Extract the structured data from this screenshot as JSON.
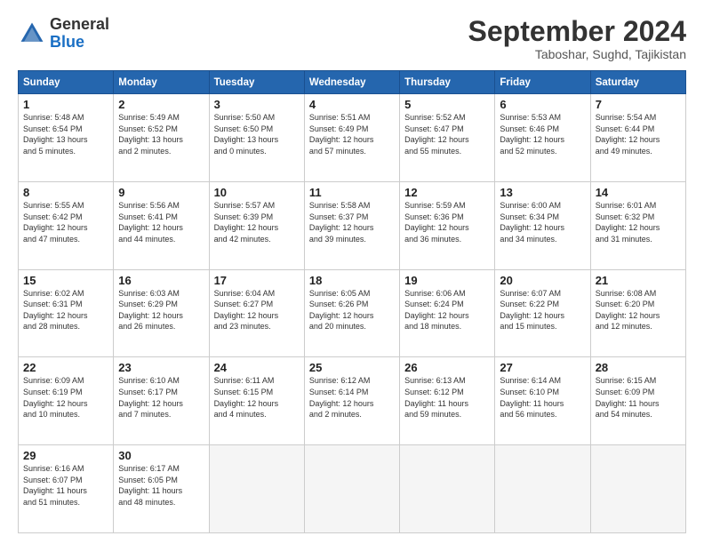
{
  "header": {
    "logo_general": "General",
    "logo_blue": "Blue",
    "month_year": "September 2024",
    "location": "Taboshar, Sughd, Tajikistan"
  },
  "weekdays": [
    "Sunday",
    "Monday",
    "Tuesday",
    "Wednesday",
    "Thursday",
    "Friday",
    "Saturday"
  ],
  "weeks": [
    [
      {
        "day": "1",
        "lines": [
          "Sunrise: 5:48 AM",
          "Sunset: 6:54 PM",
          "Daylight: 13 hours",
          "and 5 minutes."
        ]
      },
      {
        "day": "2",
        "lines": [
          "Sunrise: 5:49 AM",
          "Sunset: 6:52 PM",
          "Daylight: 13 hours",
          "and 2 minutes."
        ]
      },
      {
        "day": "3",
        "lines": [
          "Sunrise: 5:50 AM",
          "Sunset: 6:50 PM",
          "Daylight: 13 hours",
          "and 0 minutes."
        ]
      },
      {
        "day": "4",
        "lines": [
          "Sunrise: 5:51 AM",
          "Sunset: 6:49 PM",
          "Daylight: 12 hours",
          "and 57 minutes."
        ]
      },
      {
        "day": "5",
        "lines": [
          "Sunrise: 5:52 AM",
          "Sunset: 6:47 PM",
          "Daylight: 12 hours",
          "and 55 minutes."
        ]
      },
      {
        "day": "6",
        "lines": [
          "Sunrise: 5:53 AM",
          "Sunset: 6:46 PM",
          "Daylight: 12 hours",
          "and 52 minutes."
        ]
      },
      {
        "day": "7",
        "lines": [
          "Sunrise: 5:54 AM",
          "Sunset: 6:44 PM",
          "Daylight: 12 hours",
          "and 49 minutes."
        ]
      }
    ],
    [
      {
        "day": "8",
        "lines": [
          "Sunrise: 5:55 AM",
          "Sunset: 6:42 PM",
          "Daylight: 12 hours",
          "and 47 minutes."
        ]
      },
      {
        "day": "9",
        "lines": [
          "Sunrise: 5:56 AM",
          "Sunset: 6:41 PM",
          "Daylight: 12 hours",
          "and 44 minutes."
        ]
      },
      {
        "day": "10",
        "lines": [
          "Sunrise: 5:57 AM",
          "Sunset: 6:39 PM",
          "Daylight: 12 hours",
          "and 42 minutes."
        ]
      },
      {
        "day": "11",
        "lines": [
          "Sunrise: 5:58 AM",
          "Sunset: 6:37 PM",
          "Daylight: 12 hours",
          "and 39 minutes."
        ]
      },
      {
        "day": "12",
        "lines": [
          "Sunrise: 5:59 AM",
          "Sunset: 6:36 PM",
          "Daylight: 12 hours",
          "and 36 minutes."
        ]
      },
      {
        "day": "13",
        "lines": [
          "Sunrise: 6:00 AM",
          "Sunset: 6:34 PM",
          "Daylight: 12 hours",
          "and 34 minutes."
        ]
      },
      {
        "day": "14",
        "lines": [
          "Sunrise: 6:01 AM",
          "Sunset: 6:32 PM",
          "Daylight: 12 hours",
          "and 31 minutes."
        ]
      }
    ],
    [
      {
        "day": "15",
        "lines": [
          "Sunrise: 6:02 AM",
          "Sunset: 6:31 PM",
          "Daylight: 12 hours",
          "and 28 minutes."
        ]
      },
      {
        "day": "16",
        "lines": [
          "Sunrise: 6:03 AM",
          "Sunset: 6:29 PM",
          "Daylight: 12 hours",
          "and 26 minutes."
        ]
      },
      {
        "day": "17",
        "lines": [
          "Sunrise: 6:04 AM",
          "Sunset: 6:27 PM",
          "Daylight: 12 hours",
          "and 23 minutes."
        ]
      },
      {
        "day": "18",
        "lines": [
          "Sunrise: 6:05 AM",
          "Sunset: 6:26 PM",
          "Daylight: 12 hours",
          "and 20 minutes."
        ]
      },
      {
        "day": "19",
        "lines": [
          "Sunrise: 6:06 AM",
          "Sunset: 6:24 PM",
          "Daylight: 12 hours",
          "and 18 minutes."
        ]
      },
      {
        "day": "20",
        "lines": [
          "Sunrise: 6:07 AM",
          "Sunset: 6:22 PM",
          "Daylight: 12 hours",
          "and 15 minutes."
        ]
      },
      {
        "day": "21",
        "lines": [
          "Sunrise: 6:08 AM",
          "Sunset: 6:20 PM",
          "Daylight: 12 hours",
          "and 12 minutes."
        ]
      }
    ],
    [
      {
        "day": "22",
        "lines": [
          "Sunrise: 6:09 AM",
          "Sunset: 6:19 PM",
          "Daylight: 12 hours",
          "and 10 minutes."
        ]
      },
      {
        "day": "23",
        "lines": [
          "Sunrise: 6:10 AM",
          "Sunset: 6:17 PM",
          "Daylight: 12 hours",
          "and 7 minutes."
        ]
      },
      {
        "day": "24",
        "lines": [
          "Sunrise: 6:11 AM",
          "Sunset: 6:15 PM",
          "Daylight: 12 hours",
          "and 4 minutes."
        ]
      },
      {
        "day": "25",
        "lines": [
          "Sunrise: 6:12 AM",
          "Sunset: 6:14 PM",
          "Daylight: 12 hours",
          "and 2 minutes."
        ]
      },
      {
        "day": "26",
        "lines": [
          "Sunrise: 6:13 AM",
          "Sunset: 6:12 PM",
          "Daylight: 11 hours",
          "and 59 minutes."
        ]
      },
      {
        "day": "27",
        "lines": [
          "Sunrise: 6:14 AM",
          "Sunset: 6:10 PM",
          "Daylight: 11 hours",
          "and 56 minutes."
        ]
      },
      {
        "day": "28",
        "lines": [
          "Sunrise: 6:15 AM",
          "Sunset: 6:09 PM",
          "Daylight: 11 hours",
          "and 54 minutes."
        ]
      }
    ],
    [
      {
        "day": "29",
        "lines": [
          "Sunrise: 6:16 AM",
          "Sunset: 6:07 PM",
          "Daylight: 11 hours",
          "and 51 minutes."
        ]
      },
      {
        "day": "30",
        "lines": [
          "Sunrise: 6:17 AM",
          "Sunset: 6:05 PM",
          "Daylight: 11 hours",
          "and 48 minutes."
        ]
      },
      {
        "day": "",
        "lines": []
      },
      {
        "day": "",
        "lines": []
      },
      {
        "day": "",
        "lines": []
      },
      {
        "day": "",
        "lines": []
      },
      {
        "day": "",
        "lines": []
      }
    ]
  ]
}
